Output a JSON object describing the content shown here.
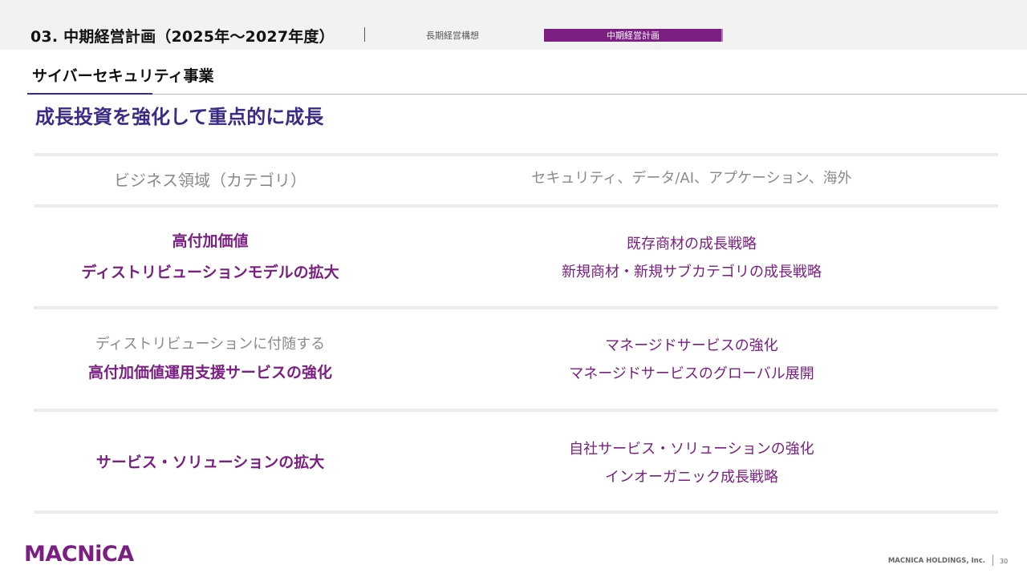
{
  "header": {
    "title": "03. 中期経営計画（2025年～2027年度）",
    "nav_tabs": [
      {
        "label": "長期経営構想",
        "active": false
      },
      {
        "label": "中期経営計画",
        "active": true
      }
    ]
  },
  "section": {
    "title": "サイバーセキュリティ事業"
  },
  "main": {
    "heading": "成長投資を強化して重点的に成長",
    "table": {
      "header": {
        "left": "ビジネス領域（カテゴリ）",
        "right": "セキュリティ、データ/AI、アプケーション、海外"
      },
      "rows": [
        {
          "left_sub": "高付加価値",
          "left_main": "ディストリビューションモデルの拡大",
          "right": [
            "既存商材の成長戦略",
            "新規商材・新規サブカテゴリの成長戦略"
          ]
        },
        {
          "left_sub": "ディストリビューションに付随する",
          "left_main": "高付加価値運用支援サービスの強化",
          "right": [
            "マネージドサービスの強化",
            "マネージドサービスのグローバル展開"
          ]
        },
        {
          "left_main": "サービス・ソリューションの拡大",
          "right": [
            "自社サービス・ソリューションの強化",
            "インオーガニック成長戦略"
          ]
        }
      ]
    }
  },
  "footer": {
    "logo_text": "MACNiCA",
    "company": "MACNICA HOLDINGS, Inc.",
    "page_number": "30"
  },
  "colors": {
    "accent_purple": "#7b1f82",
    "heading_navy": "#3b2a86",
    "muted_grey": "#8a8a8a",
    "topbar_bg": "#f2f2f2"
  }
}
